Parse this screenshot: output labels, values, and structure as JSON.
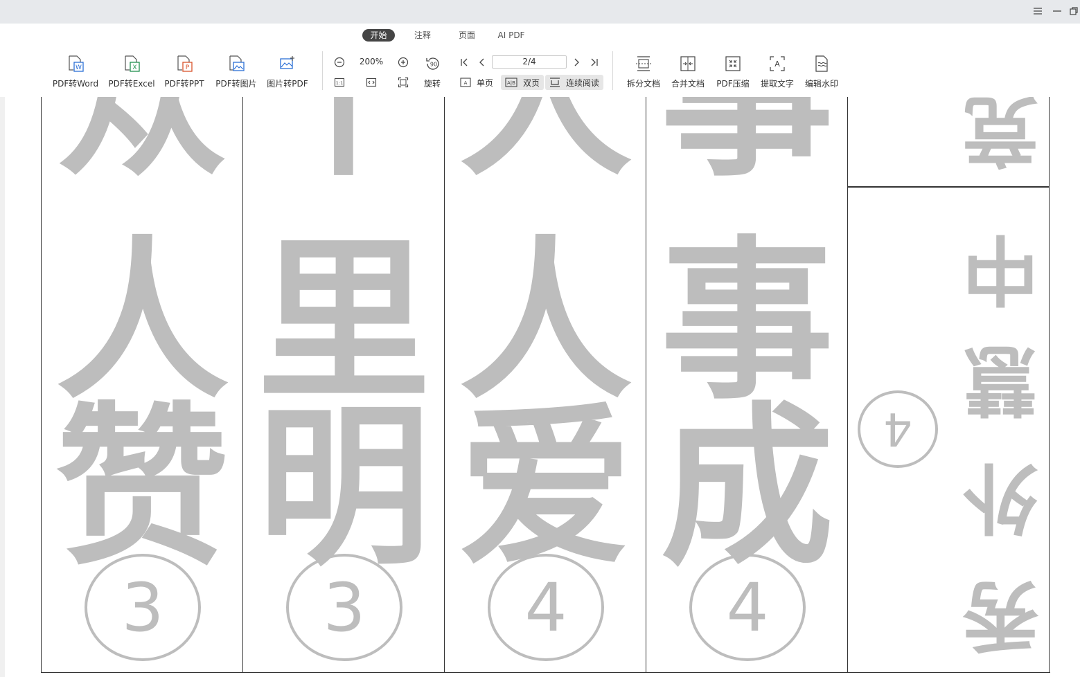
{
  "window": {
    "controls": [
      "menu-icon",
      "minimize-icon",
      "restore-icon"
    ]
  },
  "tabs": [
    {
      "label": "开始",
      "active": true
    },
    {
      "label": "注释",
      "active": false
    },
    {
      "label": "页面",
      "active": false
    },
    {
      "label": "AI PDF",
      "active": false
    }
  ],
  "toolbar": {
    "convert": [
      {
        "label": "PDF转Word",
        "icon": "pdf-to-word-icon",
        "color": "#2b6fd6"
      },
      {
        "label": "PDF转Excel",
        "icon": "pdf-to-excel-icon",
        "color": "#1f8f4e"
      },
      {
        "label": "PDF转PPT",
        "icon": "pdf-to-ppt-icon",
        "color": "#d9532b"
      },
      {
        "label": "PDF转图片",
        "icon": "pdf-to-image-icon",
        "color": "#2b6fd6"
      },
      {
        "label": "图片转PDF",
        "icon": "image-to-pdf-icon",
        "color": "#2b6fd6"
      }
    ],
    "zoom": "200%",
    "rotate_label": "旋转",
    "page_indicator": "2/4",
    "view_modes": [
      {
        "label": "单页",
        "icon": "single-page-icon",
        "selected": false
      },
      {
        "label": "双页",
        "icon": "double-page-icon",
        "selected": true
      },
      {
        "label": "连续阅读",
        "icon": "continuous-read-icon",
        "selected": true
      }
    ],
    "tools": [
      {
        "label": "拆分文档",
        "icon": "split-document-icon"
      },
      {
        "label": "合并文档",
        "icon": "merge-document-icon"
      },
      {
        "label": "PDF压缩",
        "icon": "pdf-compress-icon"
      },
      {
        "label": "提取文字",
        "icon": "extract-text-icon"
      },
      {
        "label": "编辑水印",
        "icon": "edit-watermark-icon"
      }
    ]
  },
  "document": {
    "columns": [
      {
        "chars": [
          "众",
          "人",
          "赞"
        ],
        "number": "3"
      },
      {
        "chars": [
          "千",
          "里",
          "明"
        ],
        "number": "3"
      },
      {
        "chars": [
          "人",
          "人",
          "爱"
        ],
        "number": "4"
      },
      {
        "chars": [
          "事",
          "事",
          "成"
        ],
        "number": "4"
      }
    ],
    "rotated_column": {
      "top_char": "竞",
      "chars": [
        "秀",
        "外",
        "慧",
        "中"
      ],
      "number": "4"
    }
  }
}
